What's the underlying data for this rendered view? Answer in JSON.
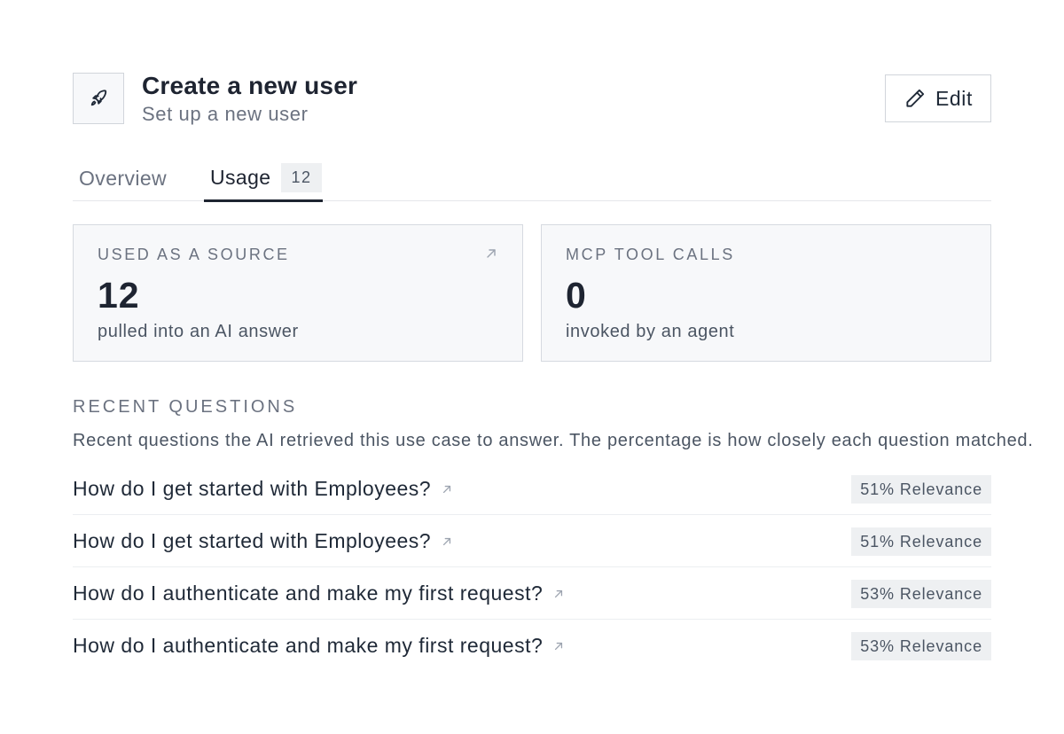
{
  "header": {
    "icon": "rocket-icon",
    "title": "Create a new user",
    "subtitle": "Set up a new user",
    "edit_label": "Edit",
    "edit_icon": "pencil-icon"
  },
  "tabs": {
    "overview": "Overview",
    "usage": "Usage",
    "usage_count": "12",
    "active": "Usage"
  },
  "stats": {
    "source": {
      "label": "USED AS A SOURCE",
      "value": "12",
      "sub": "pulled into an AI answer",
      "icon": "external-arrow-icon"
    },
    "mcp": {
      "label": "MCP TOOL CALLS",
      "value": "0",
      "sub": "invoked by an agent"
    }
  },
  "recent": {
    "title": "RECENT QUESTIONS",
    "description": "Recent questions the AI retrieved this use case to answer. The percentage is how closely each question matched.",
    "items": [
      {
        "question": "How do I get started with Employees?",
        "relevance": "51% Relevance"
      },
      {
        "question": "How do I get started with Employees?",
        "relevance": "51% Relevance"
      },
      {
        "question": "How do I authenticate and make my first request?",
        "relevance": "53% Relevance"
      },
      {
        "question": "How do I authenticate and make my first request?",
        "relevance": "53% Relevance"
      }
    ]
  },
  "colors": {
    "text_primary": "#1e2431",
    "text_muted": "#6b7280",
    "card_bg": "#f7f8fa",
    "badge_bg": "#eef0f2",
    "border": "#d1d5db"
  }
}
